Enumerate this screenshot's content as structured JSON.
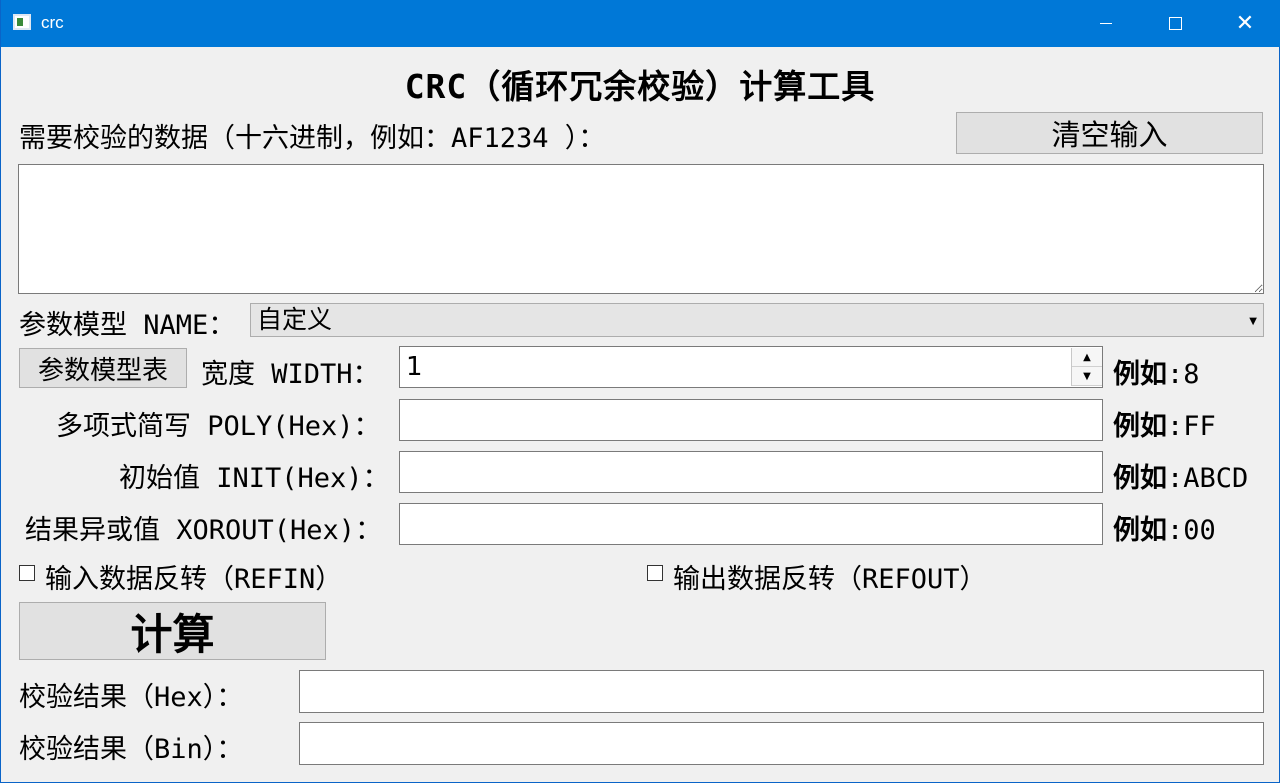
{
  "window": {
    "title": "crc"
  },
  "heading": "CRC（循环冗余校验）计算工具",
  "input_section": {
    "label": "需要校验的数据（十六进制，例如：AF1234 ）：",
    "clear_button": "清空输入",
    "data_value": ""
  },
  "model": {
    "label": "参数模型 NAME：",
    "selected": "自定义",
    "table_button": "参数模型表"
  },
  "width": {
    "label": "宽度 WIDTH：",
    "value": "1",
    "example_prefix": "例如",
    "example_value": ":8"
  },
  "poly": {
    "label": "多项式简写 POLY(Hex)：",
    "value": "",
    "example_prefix": "例如",
    "example_value": ":FF"
  },
  "init": {
    "label": "初始值 INIT(Hex)：",
    "value": "",
    "example_prefix": "例如",
    "example_value": ":ABCD"
  },
  "xorout": {
    "label": "结果异或值 XOROUT(Hex)：",
    "value": "",
    "example_prefix": "例如",
    "example_value": ":00"
  },
  "refin": {
    "label": "输入数据反转（REFIN）",
    "checked": false
  },
  "refout": {
    "label": "输出数据反转（REFOUT）",
    "checked": false
  },
  "calc_button": "计算",
  "result_hex": {
    "label": "校验结果（Hex）：",
    "value": ""
  },
  "result_bin": {
    "label": "校验结果（Bin）：",
    "value": ""
  },
  "icons": {
    "minimize": "minimize-icon",
    "maximize": "maximize-icon",
    "close": "close-icon",
    "dropdown": "chevron-down-icon",
    "spin_up": "chevron-up-icon",
    "spin_down": "chevron-down-icon"
  },
  "colors": {
    "titlebar": "#0078d7",
    "window_bg": "#f0f0f0",
    "button_bg": "#e1e1e1"
  }
}
